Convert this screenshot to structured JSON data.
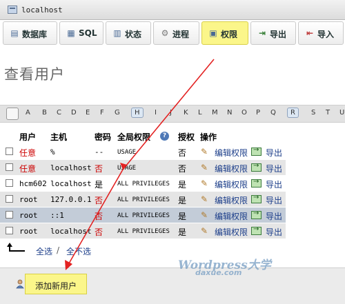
{
  "topbar": {
    "host": "localhost",
    "icon": "server-icon"
  },
  "tabs": [
    {
      "label": "数据库",
      "icon": "database-icon",
      "active": false
    },
    {
      "label": "SQL",
      "icon": "sql-icon",
      "active": false
    },
    {
      "label": "状态",
      "icon": "status-icon",
      "active": false
    },
    {
      "label": "进程",
      "icon": "gear-icon",
      "active": false
    },
    {
      "label": "权限",
      "icon": "privileges-icon",
      "active": true
    },
    {
      "label": "导出",
      "icon": "export-icon",
      "active": false
    },
    {
      "label": "导入",
      "icon": "import-icon",
      "active": false
    }
  ],
  "page_title": "查看用户",
  "letters": [
    "A",
    "B",
    "C",
    "D",
    "E",
    "F",
    "G",
    "H",
    "I",
    "J",
    "K",
    "L",
    "M",
    "N",
    "O",
    "P",
    "Q",
    "R",
    "S",
    "T",
    "U"
  ],
  "letters_boxed": [
    "H",
    "R"
  ],
  "table": {
    "headers": [
      "用户",
      "主机",
      "密码",
      "全局权限",
      "授权",
      "操作"
    ],
    "rows": [
      {
        "user": "任意",
        "host": "%",
        "password": "--",
        "privs": "USAGE",
        "grant": "否",
        "edit": "编辑权限",
        "export": "导出",
        "user_red": true,
        "pwd_red": false
      },
      {
        "user": "任意",
        "host": "localhost",
        "password": "否",
        "privs": "USAGE",
        "grant": "否",
        "edit": "编辑权限",
        "export": "导出",
        "user_red": true,
        "pwd_red": true
      },
      {
        "user": "hcm602",
        "host": "localhost",
        "password": "是",
        "privs": "ALL PRIVILEGES",
        "grant": "是",
        "edit": "编辑权限",
        "export": "导出",
        "user_red": false,
        "pwd_red": false
      },
      {
        "user": "root",
        "host": "127.0.0.1",
        "password": "否",
        "privs": "ALL PRIVILEGES",
        "grant": "是",
        "edit": "编辑权限",
        "export": "导出",
        "user_red": false,
        "pwd_red": true
      },
      {
        "user": "root",
        "host": "::1",
        "password": "否",
        "privs": "ALL PRIVILEGES",
        "grant": "是",
        "edit": "编辑权限",
        "export": "导出",
        "user_red": false,
        "pwd_red": true
      },
      {
        "user": "root",
        "host": "localhost",
        "password": "否",
        "privs": "ALL PRIVILEGES",
        "grant": "是",
        "edit": "编辑权限",
        "export": "导出",
        "user_red": false,
        "pwd_red": true
      }
    ]
  },
  "select": {
    "all": "全选",
    "separator": "/",
    "none": "全不选"
  },
  "add_user": "添加新用户",
  "watermark": {
    "line1": "Wordpress大学",
    "line2": "daxue.com"
  },
  "colors": {
    "highlight": "#fbf68a",
    "arrow": "#e32222",
    "link": "#1c3e8a",
    "red": "#cc0000"
  }
}
